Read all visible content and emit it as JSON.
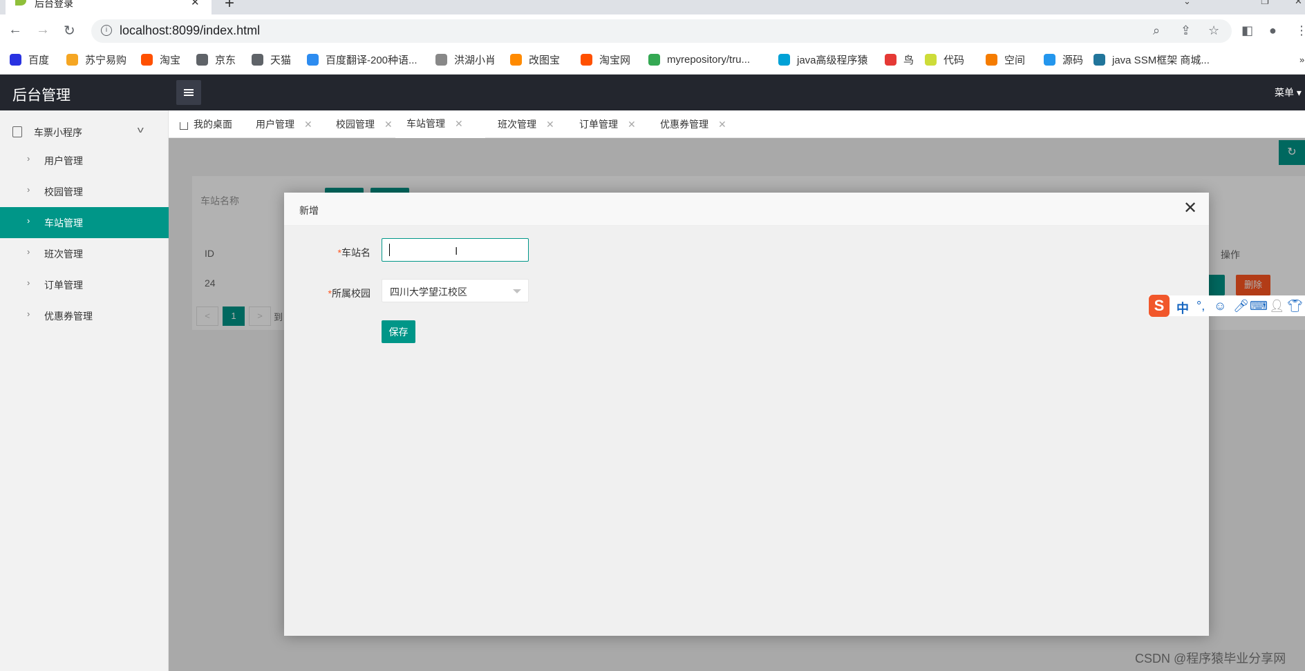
{
  "browser": {
    "tab_title": "后台登录",
    "tab_close": "✕",
    "new_tab": "+",
    "url": "localhost:8099/index.html",
    "bookmarks": [
      {
        "label": "百度",
        "icon": "baidu-icon",
        "color": "#2932e1"
      },
      {
        "label": "苏宁易购",
        "icon": "suning-icon",
        "color": "#f5a623"
      },
      {
        "label": "淘宝",
        "icon": "taobao-icon",
        "color": "#ff5000"
      },
      {
        "label": "京东",
        "icon": "globe-icon",
        "color": "#5f6368"
      },
      {
        "label": "天猫",
        "icon": "globe-icon",
        "color": "#5f6368"
      },
      {
        "label": "百度翻译-200种语...",
        "icon": "translate-icon",
        "color": "#2d8cf0"
      },
      {
        "label": "洪湖小肖",
        "icon": "bird-icon",
        "color": "#888888"
      },
      {
        "label": "改图宝",
        "icon": "gaitubao-icon",
        "color": "#ff8a00"
      },
      {
        "label": "淘宝网",
        "icon": "taobao-icon",
        "color": "#ff5000"
      },
      {
        "label": "myrepository/tru...",
        "icon": "chrome-icon",
        "color": "#34a853"
      },
      {
        "label": "java高级程序猿",
        "icon": "bilibili-icon",
        "color": "#00a1d6"
      },
      {
        "label": "鸟",
        "icon": "bird-icon",
        "color": "#e53935"
      },
      {
        "label": "代码",
        "icon": "code-icon",
        "color": "#cddc39"
      },
      {
        "label": "空间",
        "icon": "qzone-icon",
        "color": "#f57c00"
      },
      {
        "label": "源码",
        "icon": "docker-icon",
        "color": "#2496ed"
      },
      {
        "label": "java SSM框架 商城...",
        "icon": "wordpress-icon",
        "color": "#21759b"
      }
    ]
  },
  "app": {
    "brand": "后台管理",
    "header_menu": "菜单",
    "sidebar": {
      "group": "车票小程序",
      "items": [
        {
          "label": "用户管理",
          "active": false
        },
        {
          "label": "校园管理",
          "active": false
        },
        {
          "label": "车站管理",
          "active": true
        },
        {
          "label": "班次管理",
          "active": false
        },
        {
          "label": "订单管理",
          "active": false
        },
        {
          "label": "优惠券管理",
          "active": false
        }
      ]
    },
    "tabs": [
      {
        "label": "我的桌面",
        "closable": false,
        "active": false
      },
      {
        "label": "用户管理",
        "closable": true,
        "active": false
      },
      {
        "label": "校园管理",
        "closable": true,
        "active": false
      },
      {
        "label": "车站管理",
        "closable": true,
        "active": true
      },
      {
        "label": "班次管理",
        "closable": true,
        "active": false
      },
      {
        "label": "订单管理",
        "closable": true,
        "active": false
      },
      {
        "label": "优惠券管理",
        "closable": true,
        "active": false
      }
    ],
    "behind": {
      "search_placeholder": "车站名称",
      "col_id": "ID",
      "col_ops": "操作",
      "row_id": "24",
      "page_prev": "<",
      "page_current": "1",
      "page_next": ">",
      "page_goto": "到",
      "delete_label": "删除"
    }
  },
  "dialog": {
    "title": "新增",
    "close": "✕",
    "required_mark": "*",
    "station_label": "车站名",
    "station_value": "",
    "campus_label": "所属校园",
    "campus_value": "四川大学望江校区",
    "save_label": "保存"
  },
  "ime": {
    "logo": "S",
    "lang": "中",
    "punct": "°,",
    "items": [
      "emoji-icon",
      "microphone-icon",
      "keyboard-icon",
      "user-icon",
      "shirt-icon"
    ]
  },
  "watermark": "CSDN @程序猿毕业分享网"
}
